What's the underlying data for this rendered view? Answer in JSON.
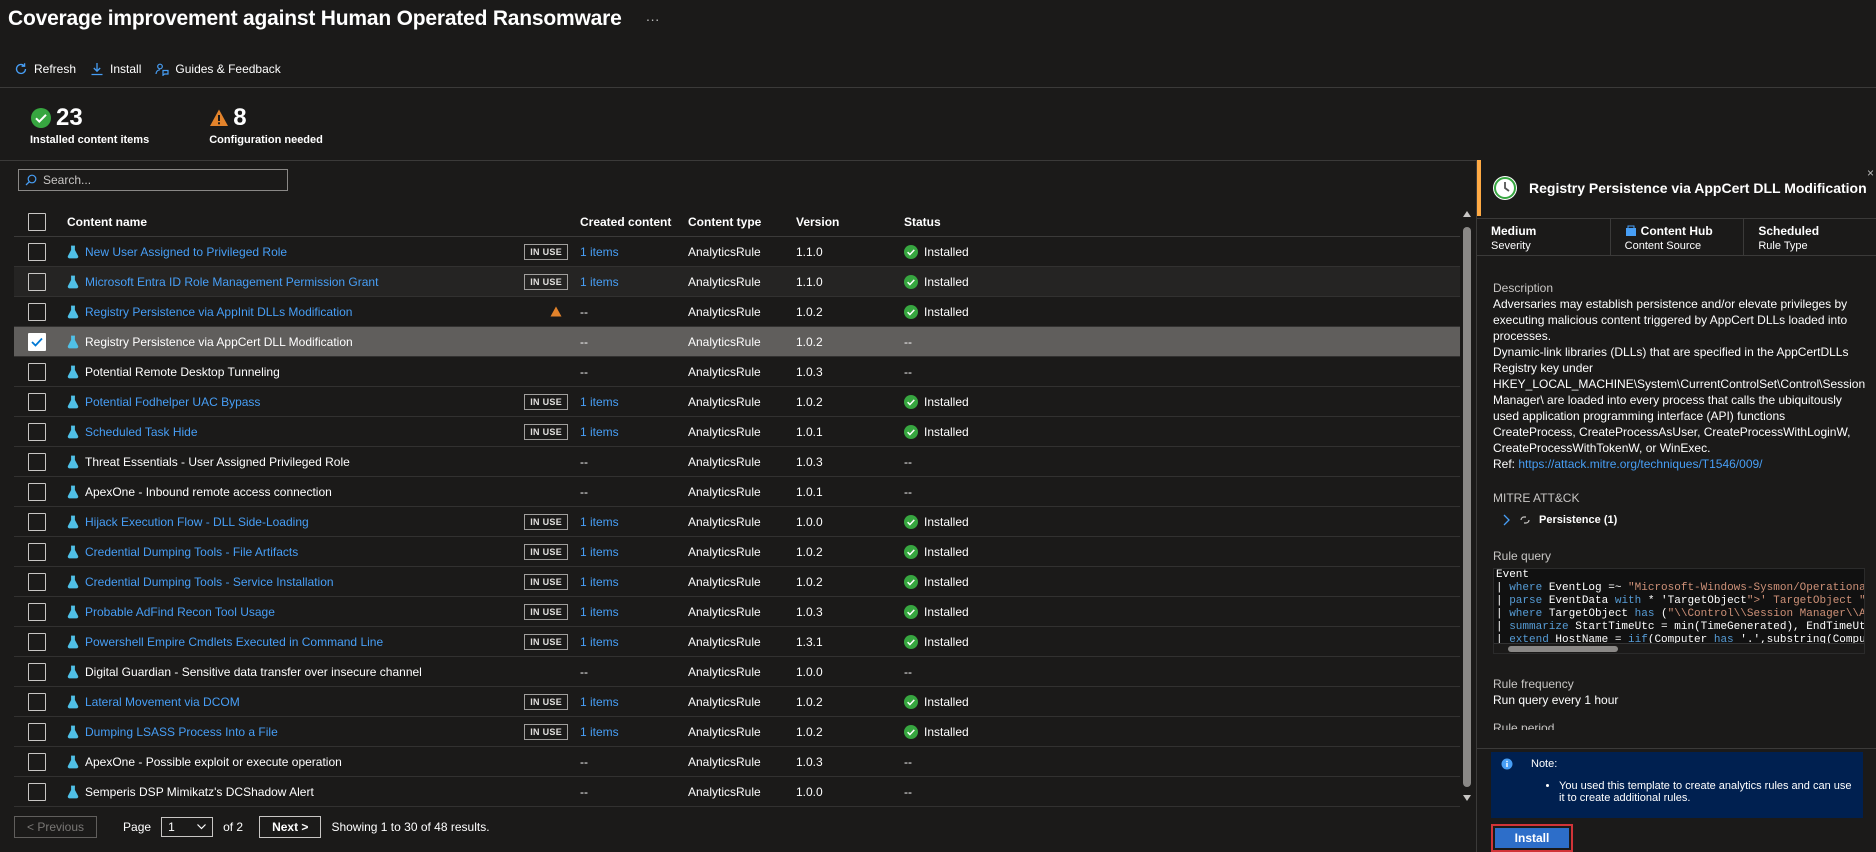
{
  "header": {
    "title": "Coverage improvement against Human Operated Ransomware",
    "more": "···"
  },
  "toolbar": {
    "refresh": "Refresh",
    "install": "Install",
    "guides": "Guides & Feedback"
  },
  "stats": [
    {
      "value": "23",
      "label": "Installed content items"
    },
    {
      "value": "8",
      "label": "Configuration needed"
    }
  ],
  "search": {
    "placeholder": "Search..."
  },
  "table": {
    "headers": {
      "name": "Content name",
      "created": "Created content",
      "type": "Content type",
      "version": "Version",
      "status": "Status"
    },
    "rows": [
      {
        "name": "New User Assigned to Privileged Role",
        "badge": "IN USE",
        "created": "1 items",
        "type": "AnalyticsRule",
        "version": "1.1.0",
        "status": "Installed"
      },
      {
        "name": "Microsoft Entra ID Role Management Permission Grant",
        "badge": "IN USE",
        "created": "1 items",
        "type": "AnalyticsRule",
        "version": "1.1.0",
        "status": "Installed"
      },
      {
        "name": "Registry Persistence via AppInit DLLs Modification",
        "badge": "",
        "created": "--",
        "type": "AnalyticsRule",
        "version": "1.0.2",
        "status": "Installed"
      },
      {
        "name": "Registry Persistence via AppCert DLL Modification",
        "badge": "",
        "created": "--",
        "type": "AnalyticsRule",
        "version": "1.0.2",
        "status": "--"
      },
      {
        "name": "Potential Remote Desktop Tunneling",
        "badge": "",
        "created": "--",
        "type": "AnalyticsRule",
        "version": "1.0.3",
        "status": "--"
      },
      {
        "name": "Potential Fodhelper UAC Bypass",
        "badge": "IN USE",
        "created": "1 items",
        "type": "AnalyticsRule",
        "version": "1.0.2",
        "status": "Installed"
      },
      {
        "name": "Scheduled Task Hide",
        "badge": "IN USE",
        "created": "1 items",
        "type": "AnalyticsRule",
        "version": "1.0.1",
        "status": "Installed"
      },
      {
        "name": "Threat Essentials - User Assigned Privileged Role",
        "badge": "",
        "created": "--",
        "type": "AnalyticsRule",
        "version": "1.0.3",
        "status": "--"
      },
      {
        "name": "ApexOne - Inbound remote access connection",
        "badge": "",
        "created": "--",
        "type": "AnalyticsRule",
        "version": "1.0.1",
        "status": "--"
      },
      {
        "name": "Hijack Execution Flow - DLL Side-Loading",
        "badge": "IN USE",
        "created": "1 items",
        "type": "AnalyticsRule",
        "version": "1.0.0",
        "status": "Installed"
      },
      {
        "name": "Credential Dumping Tools - File Artifacts",
        "badge": "IN USE",
        "created": "1 items",
        "type": "AnalyticsRule",
        "version": "1.0.2",
        "status": "Installed"
      },
      {
        "name": "Credential Dumping Tools - Service Installation",
        "badge": "IN USE",
        "created": "1 items",
        "type": "AnalyticsRule",
        "version": "1.0.2",
        "status": "Installed"
      },
      {
        "name": "Probable AdFind Recon Tool Usage",
        "badge": "IN USE",
        "created": "1 items",
        "type": "AnalyticsRule",
        "version": "1.0.3",
        "status": "Installed"
      },
      {
        "name": "Powershell Empire Cmdlets Executed in Command Line",
        "badge": "IN USE",
        "created": "1 items",
        "type": "AnalyticsRule",
        "version": "1.3.1",
        "status": "Installed"
      },
      {
        "name": "Digital Guardian - Sensitive data transfer over insecure channel",
        "badge": "",
        "created": "--",
        "type": "AnalyticsRule",
        "version": "1.0.0",
        "status": "--"
      },
      {
        "name": "Lateral Movement via DCOM",
        "badge": "IN USE",
        "created": "1 items",
        "type": "AnalyticsRule",
        "version": "1.0.2",
        "status": "Installed"
      },
      {
        "name": "Dumping LSASS Process Into a File",
        "badge": "IN USE",
        "created": "1 items",
        "type": "AnalyticsRule",
        "version": "1.0.2",
        "status": "Installed"
      },
      {
        "name": "ApexOne - Possible exploit or execute operation",
        "badge": "",
        "created": "--",
        "type": "AnalyticsRule",
        "version": "1.0.3",
        "status": "--"
      },
      {
        "name": "Semperis DSP Mimikatz's DCShadow Alert",
        "badge": "",
        "created": "--",
        "type": "AnalyticsRule",
        "version": "1.0.0",
        "status": "--"
      }
    ]
  },
  "pager": {
    "prev": "< Previous",
    "page_label": "Page",
    "page": "1",
    "of": "of 2",
    "next": "Next >",
    "summary": "Showing 1 to 30 of 48 results."
  },
  "panel": {
    "title": "Registry Persistence via AppCert DLL Modification",
    "meta": [
      {
        "value": "Medium",
        "label": "Severity"
      },
      {
        "value": "Content Hub",
        "label": "Content Source"
      },
      {
        "value": "Scheduled",
        "label": "Rule Type"
      }
    ],
    "description_label": "Description",
    "description": [
      "Adversaries may establish persistence and/or elevate privileges by executing malicious content triggered by AppCert DLLs loaded into processes.",
      "Dynamic-link libraries (DLLs) that are specified in the AppCertDLLs Registry key under HKEY_LOCAL_MACHINE\\System\\CurrentControlSet\\Control\\Session Manager\\ are loaded into every process that calls the ubiquitously used application programming interface (API) functions CreateProcess, CreateProcessAsUser, CreateProcessWithLoginW, CreateProcessWithTokenW, or WinExec."
    ],
    "ref_label": "Ref:",
    "ref_link": "https://attack.mitre.org/techniques/T1546/009/",
    "mitre_label": "MITRE ATT&CK",
    "tactic": "Persistence (1)",
    "query_label": "Rule query",
    "query_lines": [
      "Event",
      "| where EventLog =~ \"Microsoft-Windows-Sysmon/Operational\"",
      "| parse EventData with * 'TargetObject\">' TargetObject \"<",
      "| where TargetObject has (\"\\\\Control\\\\Session Manager\\\\Ap",
      "| summarize StartTimeUtc = min(TimeGenerated), EndTimeUtc",
      "| extend HostName = iif(Computer has '.',substring(Comput"
    ],
    "frequency_label": "Rule frequency",
    "frequency": "Run query every 1 hour",
    "period_label": "Rule period",
    "note_title": "Note:",
    "note_text": "You used this template to create  analytics rules and can use it to create additional rules.",
    "install": "Install"
  },
  "colors": {
    "accent": "#479ef5",
    "success": "#37a640",
    "warning": "#e3832b",
    "note_bg": "#002050",
    "install": "#2d6ec9",
    "highlight": "#d13438"
  }
}
